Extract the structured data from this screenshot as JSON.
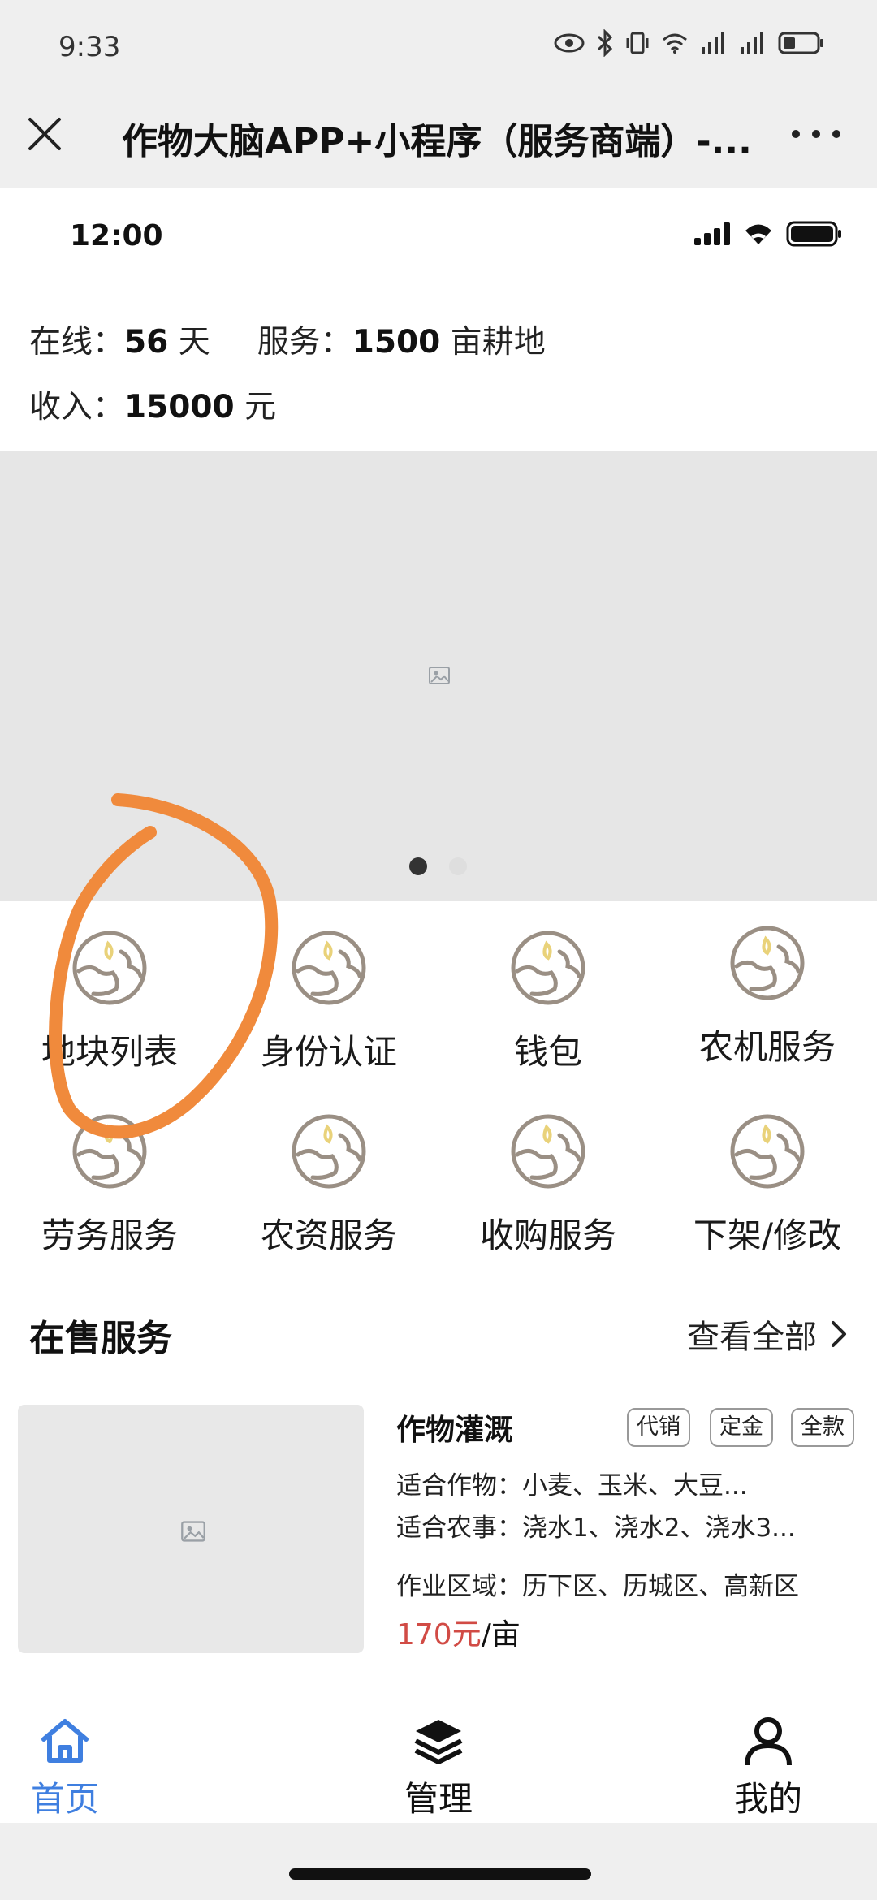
{
  "status_bar": {
    "time": "9:33"
  },
  "nav": {
    "title": "作物大脑APP+小程序（服务商端）-..."
  },
  "inner_status": {
    "time": "12:00"
  },
  "stats": {
    "online_label": "在线：",
    "online_value": "56",
    "online_unit": "天",
    "service_label": "服务：",
    "service_value": "1500",
    "service_unit": "亩耕地",
    "income_label": "收入：",
    "income_value": "15000",
    "income_unit": "元"
  },
  "banner": {
    "current_page": 1,
    "total_pages": 2
  },
  "menu": [
    {
      "label": "地块列表"
    },
    {
      "label": "身份认证"
    },
    {
      "label": "钱包"
    },
    {
      "label": "农机服务"
    },
    {
      "label": "劳务服务"
    },
    {
      "label": "农资服务"
    },
    {
      "label": "收购服务"
    },
    {
      "label": "下架/修改"
    }
  ],
  "section": {
    "title": "在售服务",
    "view_all": "查看全部"
  },
  "service": {
    "title": "作物灌溉",
    "tags": [
      "代销",
      "定金",
      "全款"
    ],
    "crops": "适合作物：小麦、玉米、大豆...",
    "tasks": "适合农事：浇水1、浇水2、浇水3...",
    "area": "作业区域：历下区、历城区、高新区",
    "price_amount": "170元",
    "price_unit": "/亩"
  },
  "tabs": [
    {
      "label": "首页",
      "icon": "home-icon",
      "active": true
    },
    {
      "label": "管理",
      "icon": "layers-icon",
      "active": false
    },
    {
      "label": "我的",
      "icon": "user-icon",
      "active": false
    }
  ],
  "colors": {
    "accent": "#3f7fe0",
    "price": "#d14b45",
    "annotation": "#f08a3c",
    "icon_brown": "#9a8f84",
    "icon_yellow": "#e9d27a"
  }
}
